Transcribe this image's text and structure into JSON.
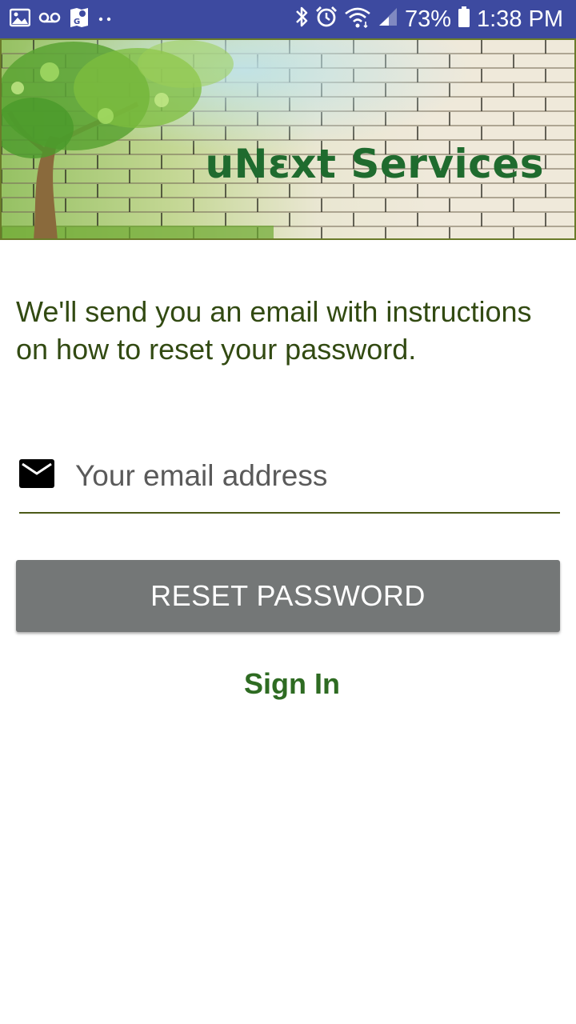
{
  "status_bar": {
    "left_icons": [
      "image-icon",
      "voicemail-icon",
      "maps-icon",
      "more-notifications-icon"
    ],
    "right_icons": [
      "bluetooth-icon",
      "alarm-icon",
      "wifi-icon",
      "signal-icon",
      "battery-icon"
    ],
    "battery_percent": "73%",
    "time": "1:38 PM",
    "background_color": "#3d4aa0"
  },
  "banner": {
    "brand": "uNεxt Services",
    "brand_color": "#1f6b2e"
  },
  "main": {
    "instructions": "We'll send you an email with instructions on how to reset your password.",
    "email": {
      "placeholder": "Your email address",
      "value": "",
      "icon": "mail-icon"
    },
    "reset_button_label": "RESET PASSWORD",
    "reset_button_color": "#747777",
    "sign_in_label": "Sign In",
    "accent_color": "#2e6b22"
  }
}
